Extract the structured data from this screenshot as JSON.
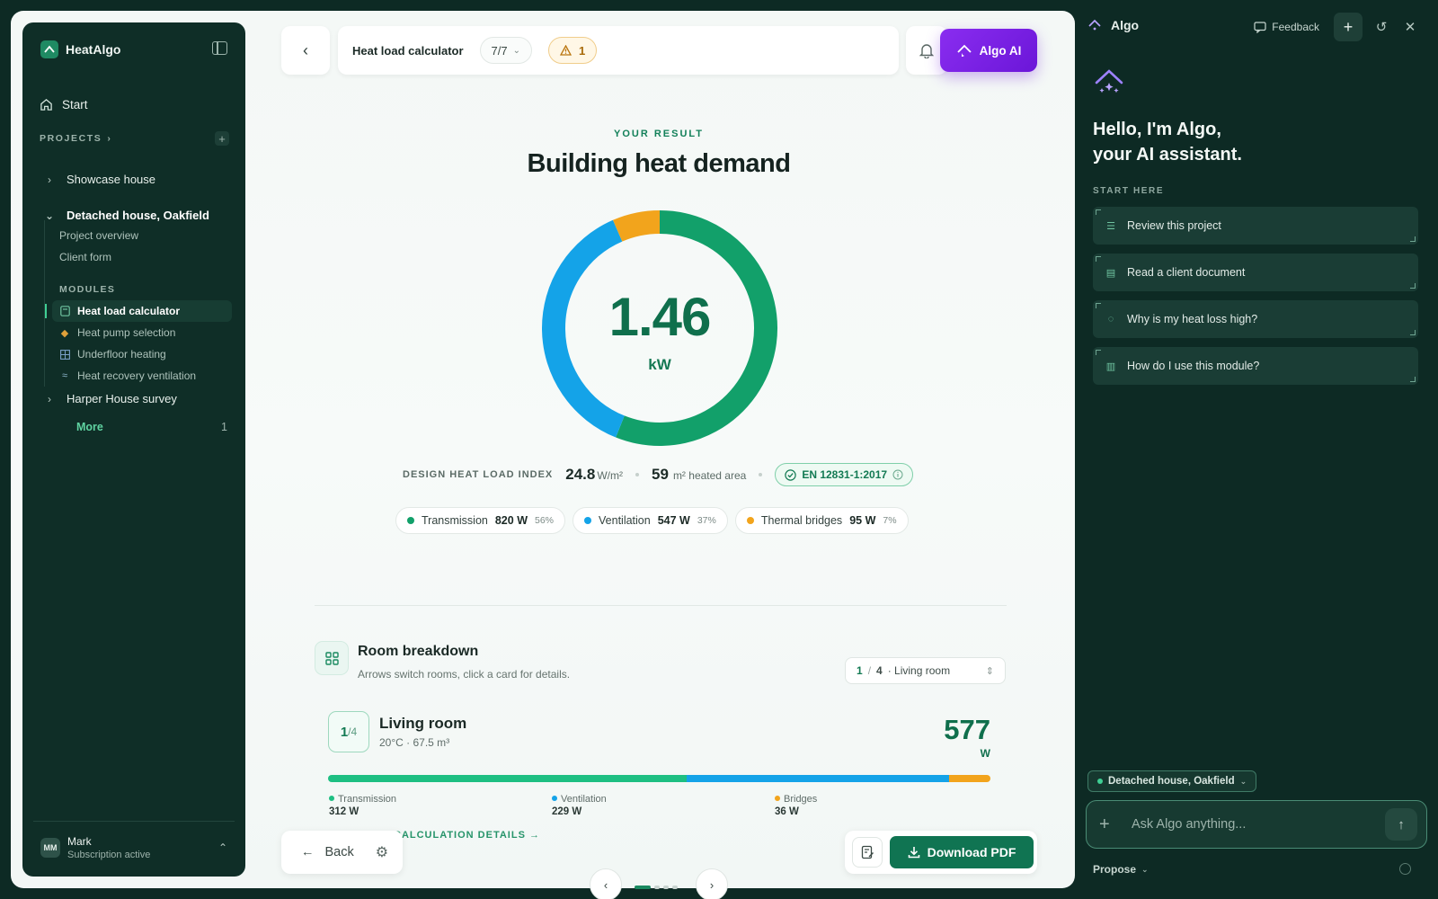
{
  "sidebar": {
    "brand": "HeatAlgo",
    "start": "Start",
    "projects_label": "PROJECTS",
    "projects": [
      {
        "name": "Showcase house"
      },
      {
        "name": "Detached house, Oakfield"
      },
      {
        "name": "Harper House survey"
      }
    ],
    "subitems": [
      "Project overview",
      "Client form"
    ],
    "modules_label": "MODULES",
    "modules": [
      {
        "label": "Heat load calculator",
        "icon": "calculator-icon"
      },
      {
        "label": "Heat pump selection",
        "icon": "flame-icon"
      },
      {
        "label": "Underfloor heating",
        "icon": "grid-icon"
      },
      {
        "label": "Heat recovery ventilation",
        "icon": "wind-icon"
      }
    ],
    "more_label": "More",
    "more_count": "1",
    "user": {
      "initials": "MM",
      "name": "Mark",
      "status": "Subscription active"
    }
  },
  "topbar": {
    "title": "Heat load calculator",
    "step": "7/7",
    "warnings": "1",
    "ai_button": "Algo AI"
  },
  "result": {
    "eyebrow": "YOUR RESULT",
    "title": "Building heat demand",
    "value": "1.46",
    "unit": "kW",
    "index_label": "DESIGN HEAT LOAD INDEX",
    "index_value": "24.8",
    "index_unit": "W/m²",
    "area_value": "59",
    "area_unit": "m² heated area",
    "norm": "EN 12831-1:2017"
  },
  "breakdown": [
    {
      "name": "Transmission",
      "value": "820 W",
      "pct": "56%",
      "share": 820,
      "color": "#12a06a"
    },
    {
      "name": "Ventilation",
      "value": "547 W",
      "pct": "37%",
      "share": 547,
      "color": "#14a3e8"
    },
    {
      "name": "Thermal bridges",
      "value": "95 W",
      "pct": "7%",
      "share": 95,
      "color": "#f2a41c"
    }
  ],
  "rooms": {
    "title": "Room breakdown",
    "subtitle": "Arrows switch rooms, click a card for details.",
    "selector": {
      "current": "1",
      "sep": "/",
      "total": "4",
      "name": "· Living room"
    },
    "room": {
      "index": "1",
      "total": "/4",
      "name": "Living room",
      "meta": "20°C · 67.5 m³",
      "watts": "577",
      "watts_unit": "W",
      "parts": [
        {
          "name": "Transmission",
          "value": "312 W",
          "share": 312,
          "color": "#1dbf82"
        },
        {
          "name": "Ventilation",
          "value": "229 W",
          "share": 229,
          "color": "#14a3e8"
        },
        {
          "name": "Bridges",
          "value": "36 W",
          "share": 36,
          "color": "#f2a41c"
        }
      ]
    },
    "details_link": "CALCULATION DETAILS →"
  },
  "footer": {
    "back": "Back",
    "download": "Download PDF"
  },
  "ai": {
    "name": "Algo",
    "feedback": "Feedback",
    "hello_line1": "Hello, I'm Algo,",
    "hello_line2": "your AI assistant.",
    "start_here": "START HERE",
    "suggestions": [
      {
        "label": "Review this project",
        "icon": "checklist-icon"
      },
      {
        "label": "Read a client document",
        "icon": "document-icon"
      },
      {
        "label": "Why is my heat loss high?",
        "icon": "chat-icon"
      },
      {
        "label": "How do I use this module?",
        "icon": "book-icon"
      }
    ],
    "context": "Detached house, Oakfield",
    "placeholder": "Ask Algo anything...",
    "mode": "Propose"
  }
}
